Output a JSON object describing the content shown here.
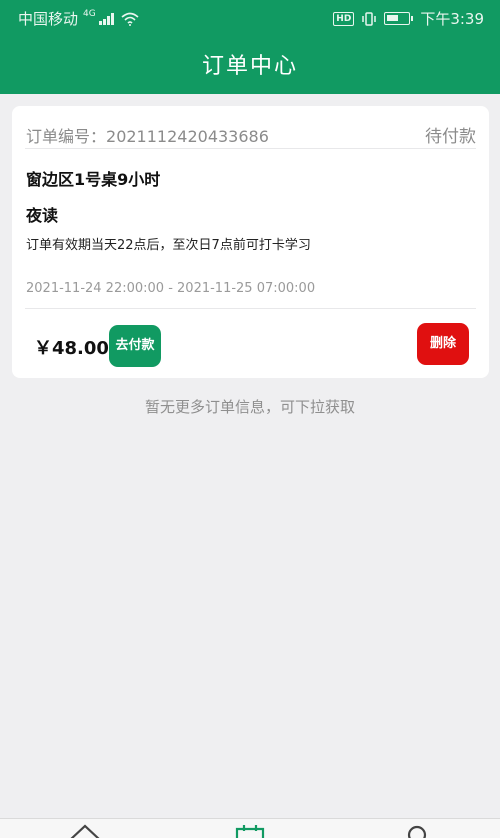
{
  "status_bar": {
    "carrier": "中国移动",
    "network": "4G",
    "time": "下午3:39",
    "hd_badge": "HD"
  },
  "header": {
    "title": "订单中心"
  },
  "order": {
    "number_label": "订单编号：",
    "number": "2021112420433686",
    "status": "待付款",
    "seat": "窗边区1号桌9小时",
    "period_name": "夜读",
    "description": "订单有效期当天22点后，至次日7点前可打卡学习",
    "time_range": "2021-11-24 22:00:00 - 2021-11-25 07:00:00",
    "price": "￥48.00",
    "pay_label": "去付款",
    "delete_label": "删除"
  },
  "footer_note": "暂无更多订单信息，可下拉获取",
  "colors": {
    "brand": "#119a62",
    "danger": "#e01010",
    "background": "#efeff1"
  },
  "tabbar": {
    "icons": [
      "home-icon",
      "orders-icon",
      "profile-icon"
    ]
  }
}
